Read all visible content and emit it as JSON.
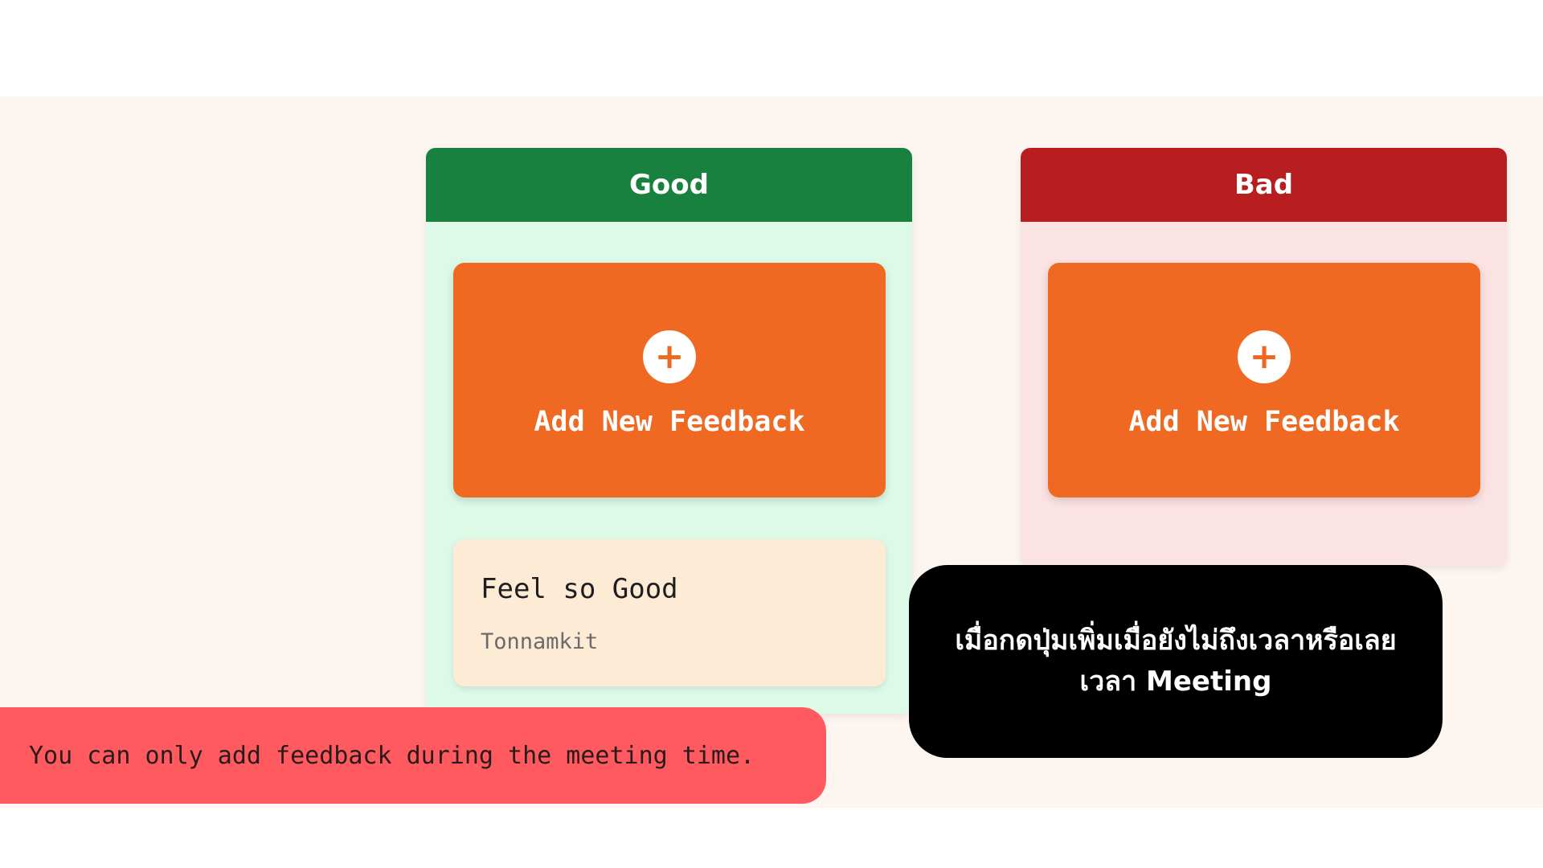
{
  "columns": [
    {
      "title": "Good",
      "header_color": "#188140",
      "background_color": "#dcfae7",
      "add_button": {
        "icon": "plus-icon",
        "label": "Add New Feedback"
      },
      "cards": [
        {
          "text": "Feel so Good",
          "author": "Tonnamkit"
        }
      ]
    },
    {
      "title": "Bad",
      "header_color": "#b81d1f",
      "background_color": "#fce3e3",
      "add_button": {
        "icon": "plus-icon",
        "label": "Add New Feedback"
      },
      "cards": []
    }
  ],
  "toast": {
    "message": "You can only add feedback during the meeting time.",
    "color": "#ff5a5f"
  },
  "caption": {
    "line1": "เมื่อกดปุ่มเพิ่มเมื่อยังไม่ถึงเวลาหรือเลย",
    "line2": "เวลา Meeting"
  },
  "colors": {
    "accent": "#f06922",
    "page_background": "#fdf5ef"
  }
}
